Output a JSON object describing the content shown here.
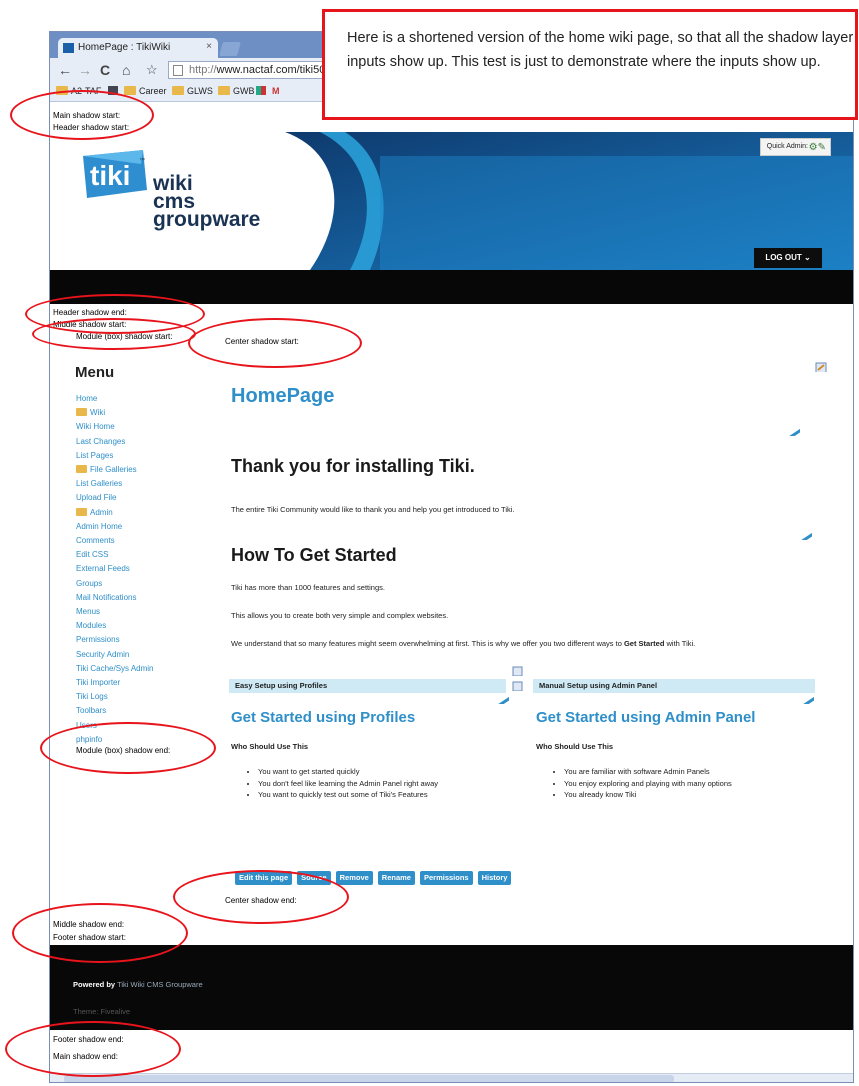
{
  "browser": {
    "tab_title": "HomePage : TikiWiki",
    "tab_close": "×",
    "url_scheme": "http://",
    "url_host": "www.nactaf.com/tiki50",
    "bookmarks": [
      "A2-TAF",
      "Career",
      "GLWS",
      "GWB",
      "M"
    ]
  },
  "annotation": {
    "callout": "Here is a shortened version of the home wiki page, so that all the shadow layer inputs show up.  This test is just to demonstrate where the inputs show up."
  },
  "shadows": {
    "main_start": "Main shadow start:",
    "header_start": "Header shadow start:",
    "header_end": "Header shadow end:",
    "middle_start": "Middle shadow start:",
    "module_start": "Module (box) shadow start:",
    "center_start": "Center shadow start:",
    "module_end": "Module (box) shadow end:",
    "center_end": "Center shadow end:",
    "middle_end": "Middle shadow end:",
    "footer_start": "Footer shadow start:",
    "footer_end": "Footer shadow end:",
    "main_end": "Main shadow end:"
  },
  "header": {
    "logo_mark": "tiki",
    "logo_tm": "™",
    "logo_lines": [
      "wiki",
      "cms",
      "groupware"
    ],
    "quick_admin": "Quick Admin:",
    "logout": "LOG OUT ⌄"
  },
  "sidebar": {
    "title": "Menu",
    "items": [
      {
        "label": "Home",
        "folder": false
      },
      {
        "label": "Wiki",
        "folder": true
      },
      {
        "label": "Wiki Home",
        "folder": false
      },
      {
        "label": "Last Changes",
        "folder": false
      },
      {
        "label": "List Pages",
        "folder": false
      },
      {
        "label": "File Galleries",
        "folder": true
      },
      {
        "label": "List Galleries",
        "folder": false
      },
      {
        "label": "Upload File",
        "folder": false
      },
      {
        "label": "Admin",
        "folder": true
      },
      {
        "label": "Admin Home",
        "folder": false
      },
      {
        "label": "Comments",
        "folder": false
      },
      {
        "label": "Edit CSS",
        "folder": false
      },
      {
        "label": "External Feeds",
        "folder": false
      },
      {
        "label": "Groups",
        "folder": false
      },
      {
        "label": "Mail Notifications",
        "folder": false
      },
      {
        "label": "Menus",
        "folder": false
      },
      {
        "label": "Modules",
        "folder": false
      },
      {
        "label": "Permissions",
        "folder": false
      },
      {
        "label": "Security Admin",
        "folder": false
      },
      {
        "label": "Tiki Cache/Sys Admin",
        "folder": false
      },
      {
        "label": "Tiki Importer",
        "folder": false
      },
      {
        "label": "Tiki Logs",
        "folder": false
      },
      {
        "label": "Toolbars",
        "folder": false
      },
      {
        "label": "Users",
        "folder": false
      },
      {
        "label": "phpinfo",
        "folder": false
      }
    ]
  },
  "content": {
    "page_title": "HomePage",
    "thanks_heading": "Thank you for installing Tiki.",
    "thanks_text": "The entire Tiki Community would like to thank you and help you get introduced to Tiki.",
    "howto_heading": "How To Get Started",
    "p1": "Tiki has more than 1000 features and settings.",
    "p2": "This allows you to create both very simple and complex websites.",
    "p3_a": "We understand that so many features might seem overwhelming at first. This is why we offer you two different ways to ",
    "p3_b": "Get Started",
    "p3_c": " with Tiki.",
    "left": {
      "bar": "Easy Setup using Profiles",
      "heading": "Get Started using Profiles",
      "who": "Who Should Use This",
      "bullets": [
        "You want to get started quickly",
        "You don't feel like learning the Admin Panel right away",
        "You want to quickly test out some of Tiki's Features"
      ]
    },
    "right": {
      "bar": "Manual Setup using Admin Panel",
      "heading": "Get Started using Admin Panel",
      "who": "Who Should Use This",
      "bullets": [
        "You are familiar with software Admin Panels",
        "You enjoy exploring and playing with many options",
        "You already know Tiki"
      ]
    },
    "actions": [
      "Edit this page",
      "Source",
      "Remove",
      "Rename",
      "Permissions",
      "History"
    ]
  },
  "footer": {
    "powered_by": "Powered by",
    "powered_link": "Tiki Wiki CMS Groupware",
    "theme": "Theme: Fivealive"
  },
  "colors": {
    "accent_blue": "#2f8fc9",
    "annotation_red": "#e8141c",
    "header_dark": "#070707"
  }
}
